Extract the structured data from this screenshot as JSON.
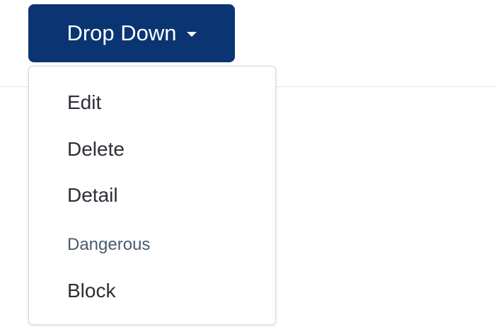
{
  "dropdown": {
    "toggle_label": "Drop Down",
    "items": [
      {
        "label": "Edit"
      },
      {
        "label": "Delete"
      },
      {
        "label": "Detail"
      },
      {
        "label": "Dangerous"
      },
      {
        "label": "Block"
      }
    ]
  },
  "colors": {
    "button_bg": "#0a3572",
    "button_text": "#ffffff",
    "menu_border": "#d6d9de",
    "menu_text": "#2b2f36",
    "danger_text": "#4a5a70"
  },
  "icons": {
    "toggle_caret": "caret-down-icon"
  }
}
